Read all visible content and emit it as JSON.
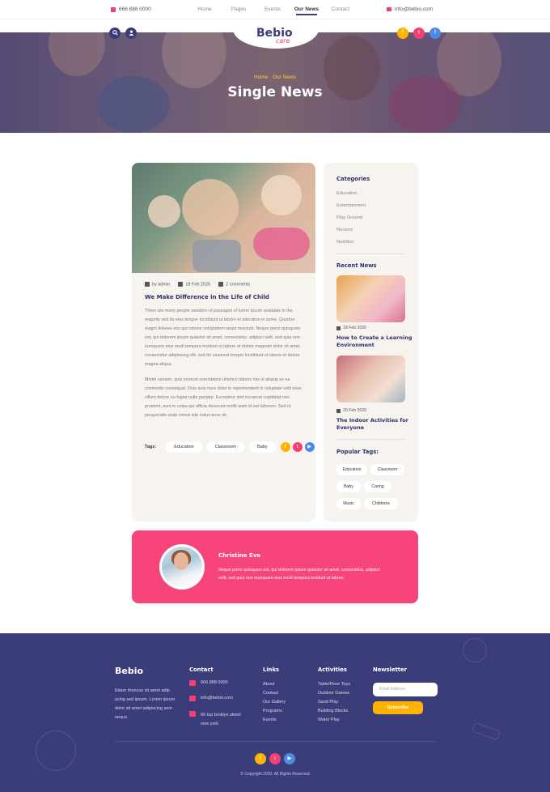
{
  "topbar": {
    "phone": "666 888 0000",
    "nav": [
      "Home",
      "Pages",
      "Events",
      "Our News",
      "Contact"
    ],
    "email": "info@bebio.com"
  },
  "brand": {
    "name": "Bebio",
    "sub": "care"
  },
  "hero": {
    "breadcrumb_home": "Home",
    "breadcrumb_current": "Our News",
    "title": "Single News"
  },
  "article": {
    "author": "by admin",
    "date": "18 Feb 2020",
    "comments": "2 comments",
    "title": "We Make Difference in the Life of Child",
    "para1": "There are many people variation of passages of lorem Ipsum available in the majority sed do eius tempor incididunt ut labore et alteration in some. Quuntur magni dolores eos qui ratione voluptatem sequi nesciunt. Neque porro quisquam est, qui dolorem ipsum quiaolor sit amet, consectetur, adipisci velit, sed quia non numquam eius modi tempora incidunt ut labore et dolore magnam dolor sit amet, consectetur adipisicing elit, sed do eiusmod tempor incididunt ut labore et dolore magna aliqua.",
    "para2": "Minim veniam, quis nostrud exercitation ullamco laboris nisi ut aliquip ex ea commodo consequat. Duis aute irure dolor in reprehenderit in voluptate velit esse cillum dolore eu fugiat nulla pariatur. Excepteur sint occaecat cupidatat non proident, sunt in culpa qui officia deserunt mollit anim id est laborum. Sed ut perspiciatis unde omnis iste natus error sit.",
    "tags_label": "Tags:",
    "tags": [
      "Education",
      "Classroom",
      "Baby"
    ]
  },
  "sidebar": {
    "categories_title": "Categories",
    "categories": [
      "Education",
      "Entertainment",
      "Play Ground",
      "Nursery",
      "Nutrition"
    ],
    "recent_title": "Recent News",
    "recent": [
      {
        "date": "18 Feb 2020",
        "title": "How to Create a Learning Environment"
      },
      {
        "date": "20 Feb 2020",
        "title": "The Indoor Activities for Everyone"
      }
    ],
    "tags_title": "Popular Tags:",
    "tags": [
      "Education",
      "Classroom",
      "Baby",
      "Caring",
      "Music",
      "Childrens"
    ]
  },
  "author_box": {
    "name": "Christine Eve",
    "bio": "Neque porro quisquam est, qui dolorem ipsum quiaolor sit amet, consectetur, adipisci velit, sed quia non numquam eius modi tempora incidunt ut labore."
  },
  "footer": {
    "logo": "Bebio",
    "desc": "Etiam rhoncus sit amet adip scing sed ipsum. Lorem ipsum dolor sit amet adipiscing sem neque.",
    "contact_title": "Contact",
    "contact_phone": "666 888 0000",
    "contact_email": "info@bebio.com",
    "contact_address": "66 top broklyn street new york",
    "links_title": "Links",
    "links": [
      "About",
      "Contact",
      "Our Gallery",
      "Programs",
      "Events"
    ],
    "activities_title": "Activities",
    "activities": [
      "Table/Floor Toys",
      "Outdoor Games",
      "Sand Play",
      "Building Blocks",
      "Water Play"
    ],
    "newsletter_title": "Newsletter",
    "email_placeholder": "Email Address",
    "subscribe": "Subscribe",
    "copyright": "© Copyright 2020. All Rights Reserved"
  },
  "colors": {
    "navy": "#3b3c7a",
    "pink": "#f43f72",
    "yellow": "#ffb400",
    "blue": "#4a8be8",
    "card": "#f7f4ef"
  },
  "icons": [
    "phone-icon",
    "mail-icon",
    "search-icon",
    "user-icon",
    "facebook-icon",
    "twitter-icon",
    "youtube-icon",
    "pencil-icon",
    "calendar-icon",
    "comment-icon",
    "location-icon"
  ]
}
